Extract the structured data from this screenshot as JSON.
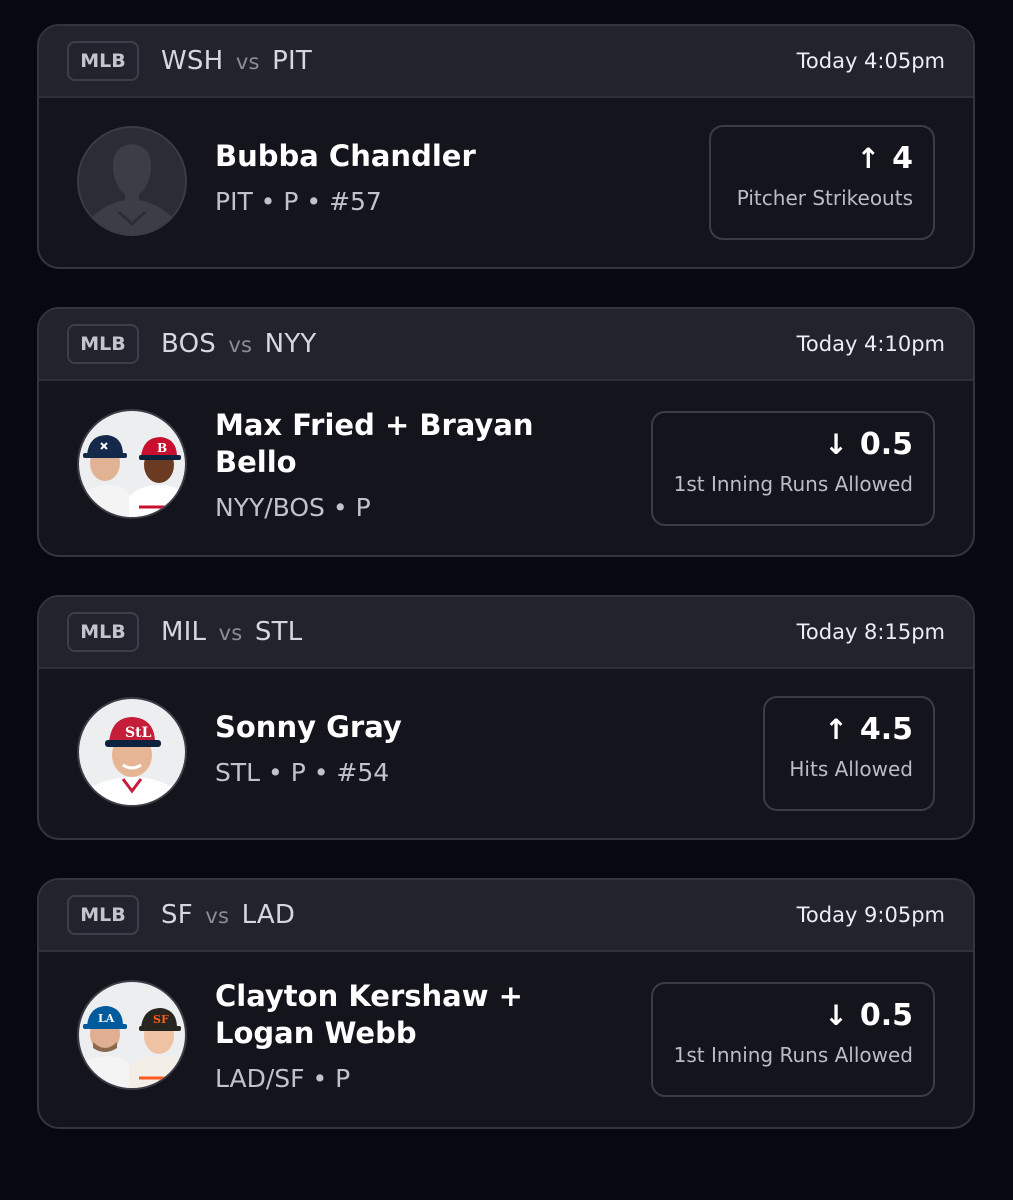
{
  "cards": [
    {
      "league": "MLB",
      "team_a": "WSH",
      "vs": "vs",
      "team_b": "PIT",
      "time": "Today 4:05pm",
      "player_name": "Bubba Chandler",
      "player_meta": "PIT • P • #57",
      "direction": "up",
      "arrow": "↑",
      "line": "4",
      "stat": "Pitcher Strikeouts",
      "avatar": "silhouette-placeholder"
    },
    {
      "league": "MLB",
      "team_a": "BOS",
      "vs": "vs",
      "team_b": "NYY",
      "time": "Today 4:10pm",
      "player_name": "Max Fried + Brayan Bello",
      "player_meta": "NYY/BOS • P",
      "direction": "down",
      "arrow": "↓",
      "line": "0.5",
      "stat": "1st Inning Runs Allowed",
      "avatar": "two-player-photos",
      "cap_colors": [
        "#14284a",
        "#c8102e"
      ]
    },
    {
      "league": "MLB",
      "team_a": "MIL",
      "vs": "vs",
      "team_b": "STL",
      "time": "Today 8:15pm",
      "player_name": "Sonny Gray",
      "player_meta": "STL • P • #54",
      "direction": "up",
      "arrow": "↑",
      "line": "4.5",
      "stat": "Hits Allowed",
      "avatar": "player-photo",
      "cap_colors": [
        "#c41e3a"
      ]
    },
    {
      "league": "MLB",
      "team_a": "SF",
      "vs": "vs",
      "team_b": "LAD",
      "time": "Today 9:05pm",
      "player_name": "Clayton Kershaw + Logan Webb",
      "player_meta": "LAD/SF • P",
      "direction": "down",
      "arrow": "↓",
      "line": "0.5",
      "stat": "1st Inning Runs Allowed",
      "avatar": "two-player-photos",
      "cap_colors": [
        "#005a9c",
        "#27251f"
      ]
    }
  ]
}
